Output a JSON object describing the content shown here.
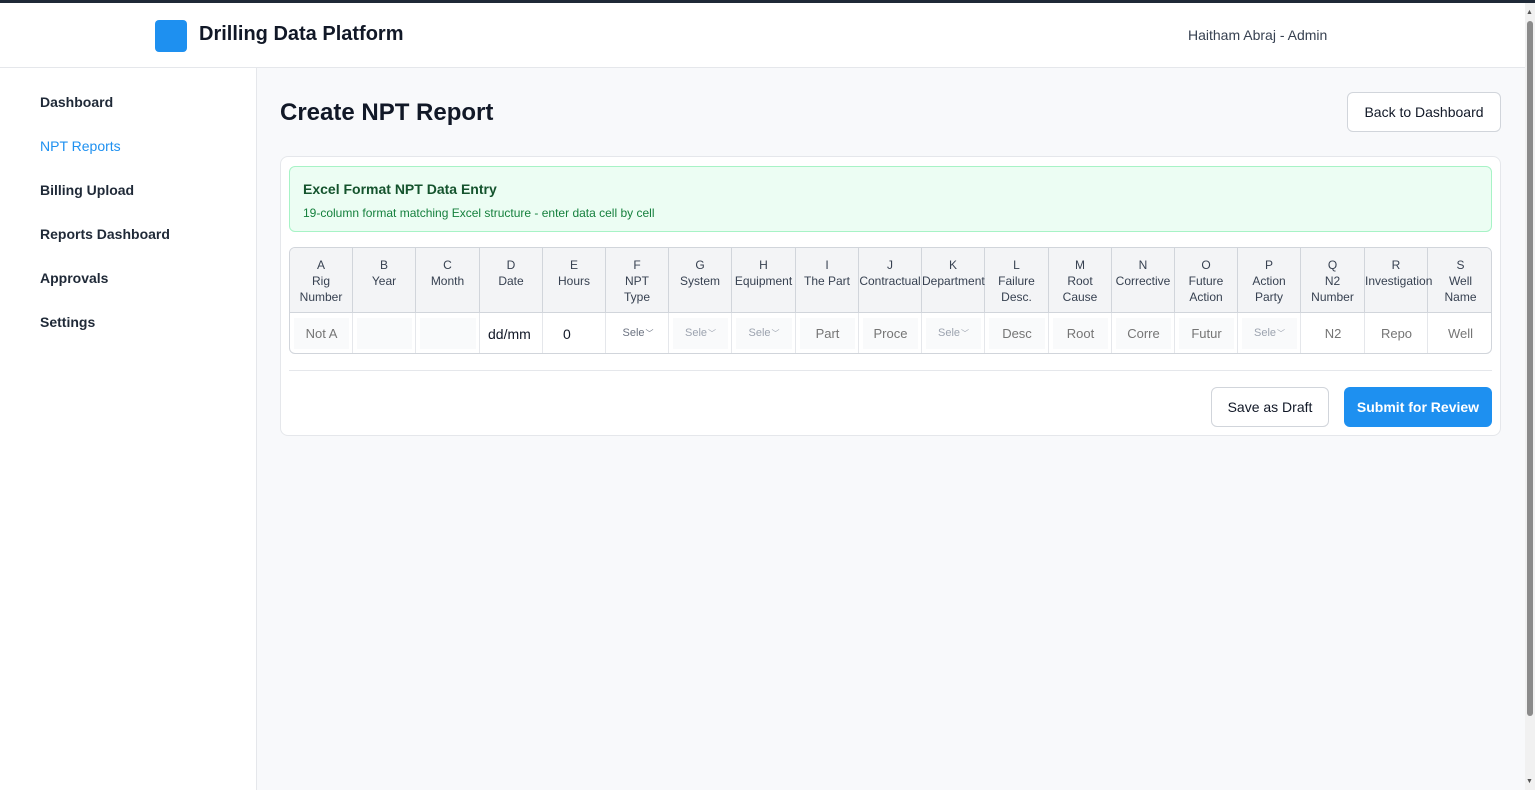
{
  "header": {
    "app_title": "Drilling Data Platform",
    "user": "Haitham Abraj - Admin"
  },
  "sidebar": {
    "items": [
      {
        "label": "Dashboard",
        "active": false
      },
      {
        "label": "NPT Reports",
        "active": true
      },
      {
        "label": "Billing Upload",
        "active": false
      },
      {
        "label": "Reports Dashboard",
        "active": false
      },
      {
        "label": "Approvals",
        "active": false
      },
      {
        "label": "Settings",
        "active": false
      }
    ]
  },
  "page": {
    "title": "Create NPT Report",
    "back_label": "Back to Dashboard"
  },
  "info": {
    "title": "Excel Format NPT Data Entry",
    "subtitle": "19-column format matching Excel structure - enter data cell by cell"
  },
  "table": {
    "columns": [
      {
        "letter": "A",
        "label": "Rig\nNumber"
      },
      {
        "letter": "B",
        "label": "Year"
      },
      {
        "letter": "C",
        "label": "Month"
      },
      {
        "letter": "D",
        "label": "Date"
      },
      {
        "letter": "E",
        "label": "Hours"
      },
      {
        "letter": "F",
        "label": "NPT\nType"
      },
      {
        "letter": "G",
        "label": "System"
      },
      {
        "letter": "H",
        "label": "Equipment"
      },
      {
        "letter": "I",
        "label": "The Part"
      },
      {
        "letter": "J",
        "label": "Contractual"
      },
      {
        "letter": "K",
        "label": "Department"
      },
      {
        "letter": "L",
        "label": "Failure\nDesc."
      },
      {
        "letter": "M",
        "label": "Root\nCause"
      },
      {
        "letter": "N",
        "label": "Corrective"
      },
      {
        "letter": "O",
        "label": "Future\nAction"
      },
      {
        "letter": "P",
        "label": "Action\nParty"
      },
      {
        "letter": "Q",
        "label": "N2\nNumber"
      },
      {
        "letter": "R",
        "label": "Investigation"
      },
      {
        "letter": "S",
        "label": "Well\nName"
      }
    ],
    "row": {
      "rig_number_placeholder": "Not A",
      "year_value": "",
      "month_value": "",
      "date_placeholder": "dd/mm",
      "hours_value": "0",
      "npt_type": "Sele",
      "system": "Sele",
      "equipment": "Sele",
      "the_part_placeholder": "Part",
      "contractual_placeholder": "Proce",
      "department": "Sele",
      "failure_desc_placeholder": "Desc",
      "root_cause_placeholder": "Root",
      "corrective_placeholder": "Corre",
      "future_action_placeholder": "Futur",
      "action_party": "Sele",
      "n2_number_placeholder": "N2",
      "investigation_placeholder": "Repo",
      "well_name_placeholder": "Well"
    }
  },
  "actions": {
    "draft_label": "Save as Draft",
    "submit_label": "Submit for Review"
  },
  "colors": {
    "accent": "#1e90f0",
    "info_bg": "#ecfdf3",
    "info_text": "#14532d"
  }
}
